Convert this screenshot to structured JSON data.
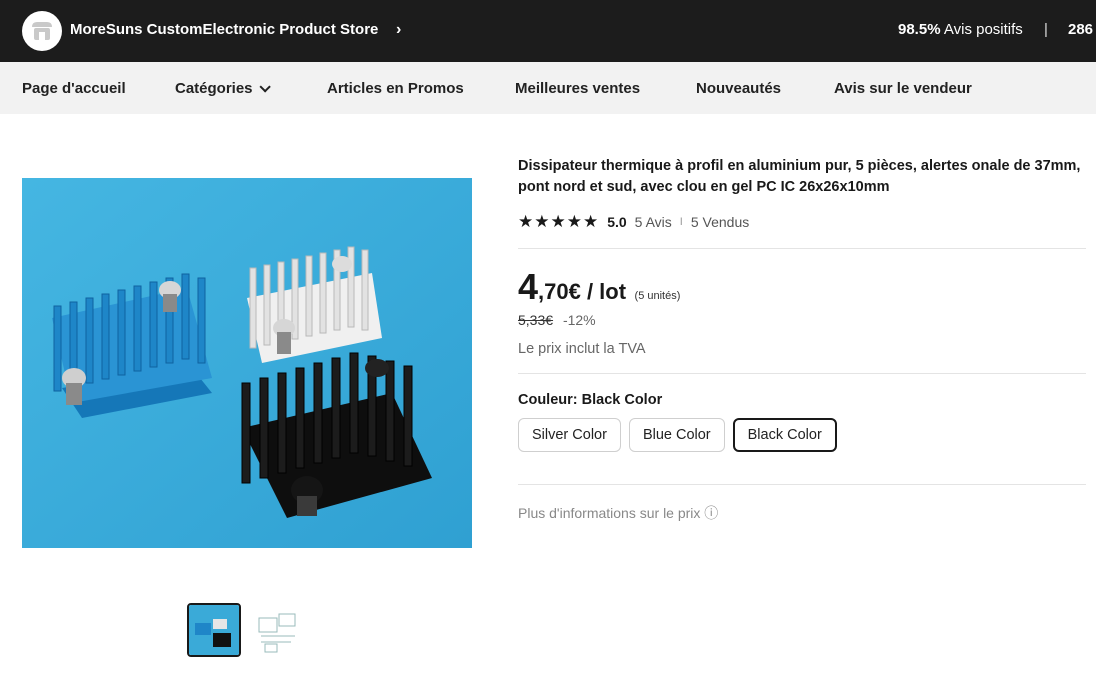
{
  "store": {
    "name": "MoreSuns CustomElectronic Product Store",
    "rating_pct": "98.5%",
    "rating_text": "Avis positifs",
    "separator": "|",
    "followers": "286"
  },
  "nav": {
    "items": [
      {
        "label": "Page d'accueil"
      },
      {
        "label": "Catégories"
      },
      {
        "label": "Articles en Promos"
      },
      {
        "label": "Meilleures ventes"
      },
      {
        "label": "Nouveautés"
      },
      {
        "label": "Avis sur le vendeur"
      }
    ]
  },
  "product": {
    "title": "Dissipateur thermique à profil en aluminium pur, 5 pièces, alertes onale de 37mm, pont nord et sud, avec clou en gel PC IC 26x26x10mm",
    "stars": "★★★★★",
    "rating": "5.0",
    "reviews": "5 Avis",
    "rating_sep": "I",
    "sold": "5 Vendus",
    "price_int": "4",
    "price_dec": ",70€ / lot",
    "price_units": "(5 unités)",
    "old_price": "5,33€",
    "discount": "-12%",
    "vat_note": "Le prix inclut la TVA",
    "color_label": "Couleur: Black Color",
    "colors": [
      {
        "label": "Silver Color",
        "selected": false
      },
      {
        "label": "Blue Color",
        "selected": false
      },
      {
        "label": "Black Color",
        "selected": true
      }
    ],
    "more_info": "Plus d'informations sur le prix ⓘ"
  },
  "colors": {
    "store_bar_bg": "#1c1c1c",
    "nav_bg": "#f2f2f2",
    "image_bg": "#3aaad8",
    "heatsink_blue": "#1f8fd0",
    "heatsink_silver": "#e6e6e6",
    "heatsink_black": "#1a1a1a"
  }
}
